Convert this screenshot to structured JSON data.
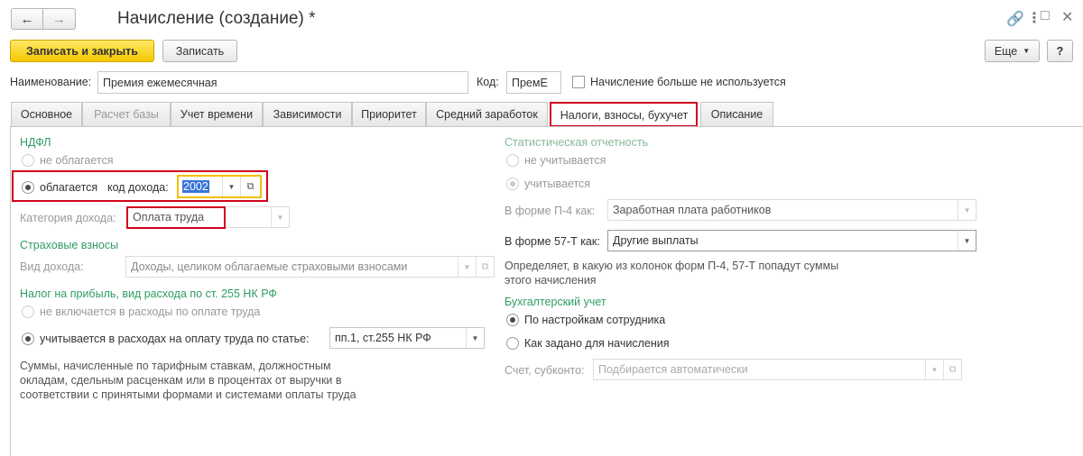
{
  "window": {
    "title": "Начисление (создание) *",
    "back_icon": "arrow-left-icon",
    "forward_icon": "arrow-right-icon",
    "link_icon": "link-icon",
    "menu_icon": "more-vertical-icon",
    "maximize_icon": "maximize-icon",
    "close_icon": "close-icon"
  },
  "toolbar": {
    "save_close_label": "Записать и закрыть",
    "save_label": "Записать",
    "more_label": "Еще",
    "help_label": "?"
  },
  "header": {
    "name_label": "Наименование:",
    "name_value": "Премия ежемесячная",
    "code_label": "Код:",
    "code_value": "ПремЕ",
    "unused_label": "Начисление больше не используется",
    "unused_checked": false
  },
  "tabs": [
    {
      "label": "Основное",
      "enabled": true
    },
    {
      "label": "Расчет базы",
      "enabled": false
    },
    {
      "label": "Учет времени",
      "enabled": true
    },
    {
      "label": "Зависимости",
      "enabled": true
    },
    {
      "label": "Приоритет",
      "enabled": true
    },
    {
      "label": "Средний заработок",
      "enabled": true
    },
    {
      "label": "Налоги, взносы, бухучет",
      "enabled": true,
      "active": true
    },
    {
      "label": "Описание",
      "enabled": true
    }
  ],
  "left": {
    "ndfl": {
      "title": "НДФЛ",
      "not_taxed_label": "не облагается",
      "taxed_label": "облагается",
      "income_code_label": "код дохода:",
      "income_code_value": "2002",
      "income_category_label": "Категория дохода:",
      "income_category_value": "Оплата труда"
    },
    "insurance": {
      "title": "Страховые взносы",
      "income_type_label": "Вид дохода:",
      "income_type_value": "Доходы, целиком облагаемые страховыми взносами"
    },
    "profit_tax": {
      "title": "Налог на прибыль, вид расхода по ст. 255 НК РФ",
      "not_included_label": "не включается в расходы по оплате труда",
      "included_label": "учитывается в расходах на оплату труда по статье:",
      "article_value": "пп.1, ст.255 НК РФ",
      "note": [
        "Суммы, начисленные по тарифным ставкам, должностным",
        "окладам, сдельным расценкам или в процентах от выручки в",
        "соответствии с принятыми формами и системами оплаты труда"
      ]
    }
  },
  "right": {
    "stat": {
      "title": "Статистическая отчетность",
      "not_counted_label": "не учитывается",
      "counted_label": "учитывается",
      "p4_label": "В форме П-4 как:",
      "p4_value": "Заработная плата работников",
      "t57_label": "В форме 57-Т как:",
      "t57_value": "Другие выплаты",
      "note": [
        "Определяет, в какую из колонок форм П-4, 57-Т попадут суммы",
        "этого начисления"
      ]
    },
    "accounting": {
      "title": "Бухгалтерский учет",
      "by_employee_label": "По настройкам сотрудника",
      "by_accrual_label": "Как задано для начисления",
      "account_label": "Счет, субконто:",
      "account_placeholder": "Подбирается автоматически"
    }
  },
  "colors": {
    "accent_green": "#2f9c63",
    "primary_button": "#f3c800",
    "highlight_red": "#d0021b",
    "focus_yellow": "#f0c000"
  }
}
